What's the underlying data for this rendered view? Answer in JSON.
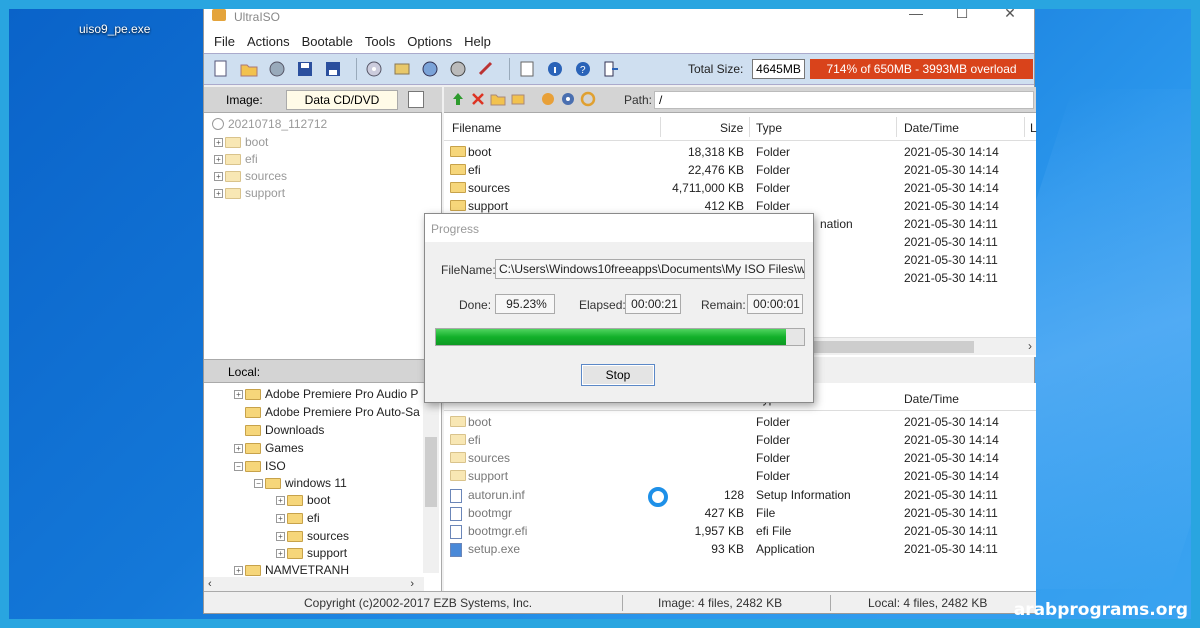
{
  "desktop": {
    "icon_label": "uiso9_pe.exe",
    "watermark": "arabprograms.org"
  },
  "window": {
    "title": "UltraISO",
    "menu": [
      "File",
      "Actions",
      "Bootable",
      "Tools",
      "Options",
      "Help"
    ],
    "toolbar": {
      "total_size_label": "Total Size:",
      "total_size_value": "4645MB",
      "overload_text": "714% of 650MB - 3993MB overload"
    },
    "image_bar": {
      "label": "Image:",
      "type": "Data CD/DVD"
    },
    "path_bar": {
      "label": "Path:",
      "value": "/"
    },
    "iso_tree": {
      "root": "20210718_112712",
      "items": [
        "boot",
        "efi",
        "sources",
        "support"
      ]
    },
    "iso_files": {
      "headers": [
        "Filename",
        "Size",
        "Type",
        "Date/Time",
        "L"
      ],
      "rows": [
        {
          "name": "boot",
          "size": "18,318 KB",
          "type": "Folder",
          "date": "2021-05-30 14:14"
        },
        {
          "name": "efi",
          "size": "22,476 KB",
          "type": "Folder",
          "date": "2021-05-30 14:14"
        },
        {
          "name": "sources",
          "size": "4,711,000 KB",
          "type": "Folder",
          "date": "2021-05-30 14:14"
        },
        {
          "name": "support",
          "size": "412 KB",
          "type": "Folder",
          "date": "2021-05-30 14:14"
        }
      ],
      "partial_type": "nation",
      "extra_dates": [
        "2021-05-30 14:11",
        "2021-05-30 14:11",
        "2021-05-30 14:11",
        "2021-05-30 14:11",
        "2021-05-30 14:11"
      ]
    },
    "local_bar": {
      "label": "Local:"
    },
    "local_tree": [
      {
        "label": "Adobe Premiere Pro Audio P"
      },
      {
        "label": "Adobe Premiere Pro Auto-Sa"
      },
      {
        "label": "Downloads"
      },
      {
        "label": "Games"
      },
      {
        "label": "ISO"
      },
      {
        "label": "windows 11"
      },
      {
        "label": "boot"
      },
      {
        "label": "efi"
      },
      {
        "label": "sources"
      },
      {
        "label": "support"
      },
      {
        "label": "NAMVETRANH"
      }
    ],
    "local_files": {
      "headers": [
        "Filename",
        "Size",
        "Type",
        "Date/Time"
      ],
      "rows": [
        {
          "name": "boot",
          "size": "",
          "type": "Folder",
          "date": "2021-05-30 14:14"
        },
        {
          "name": "efi",
          "size": "",
          "type": "Folder",
          "date": "2021-05-30 14:14"
        },
        {
          "name": "sources",
          "size": "",
          "type": "Folder",
          "date": "2021-05-30 14:14"
        },
        {
          "name": "support",
          "size": "",
          "type": "Folder",
          "date": "2021-05-30 14:14"
        },
        {
          "name": "autorun.inf",
          "size": "128",
          "type": "Setup Information",
          "date": "2021-05-30 14:11"
        },
        {
          "name": "bootmgr",
          "size": "427 KB",
          "type": "File",
          "date": "2021-05-30 14:11"
        },
        {
          "name": "bootmgr.efi",
          "size": "1,957 KB",
          "type": "efi File",
          "date": "2021-05-30 14:11"
        },
        {
          "name": "setup.exe",
          "size": "93 KB",
          "type": "Application",
          "date": "2021-05-30 14:11"
        }
      ]
    },
    "status": {
      "copyright": "Copyright (c)2002-2017 EZB Systems, Inc.",
      "image": "Image: 4 files, 2482 KB",
      "local": "Local: 4 files, 2482 KB"
    }
  },
  "progress_dialog": {
    "title": "Progress",
    "filename_label": "FileName:",
    "filename_value": "C:\\Users\\Windows10freeapps\\Documents\\My ISO Files\\w",
    "done_label": "Done:",
    "done_value": "95.23%",
    "done_fraction": 0.9523,
    "elapsed_label": "Elapsed:",
    "elapsed_value": "00:00:21",
    "remain_label": "Remain:",
    "remain_value": "00:00:01",
    "stop_label": "Stop"
  },
  "colors": {
    "accent_green": "#12b02a",
    "overload_red": "#d9431b",
    "desktop_blue": "#1478d8"
  }
}
